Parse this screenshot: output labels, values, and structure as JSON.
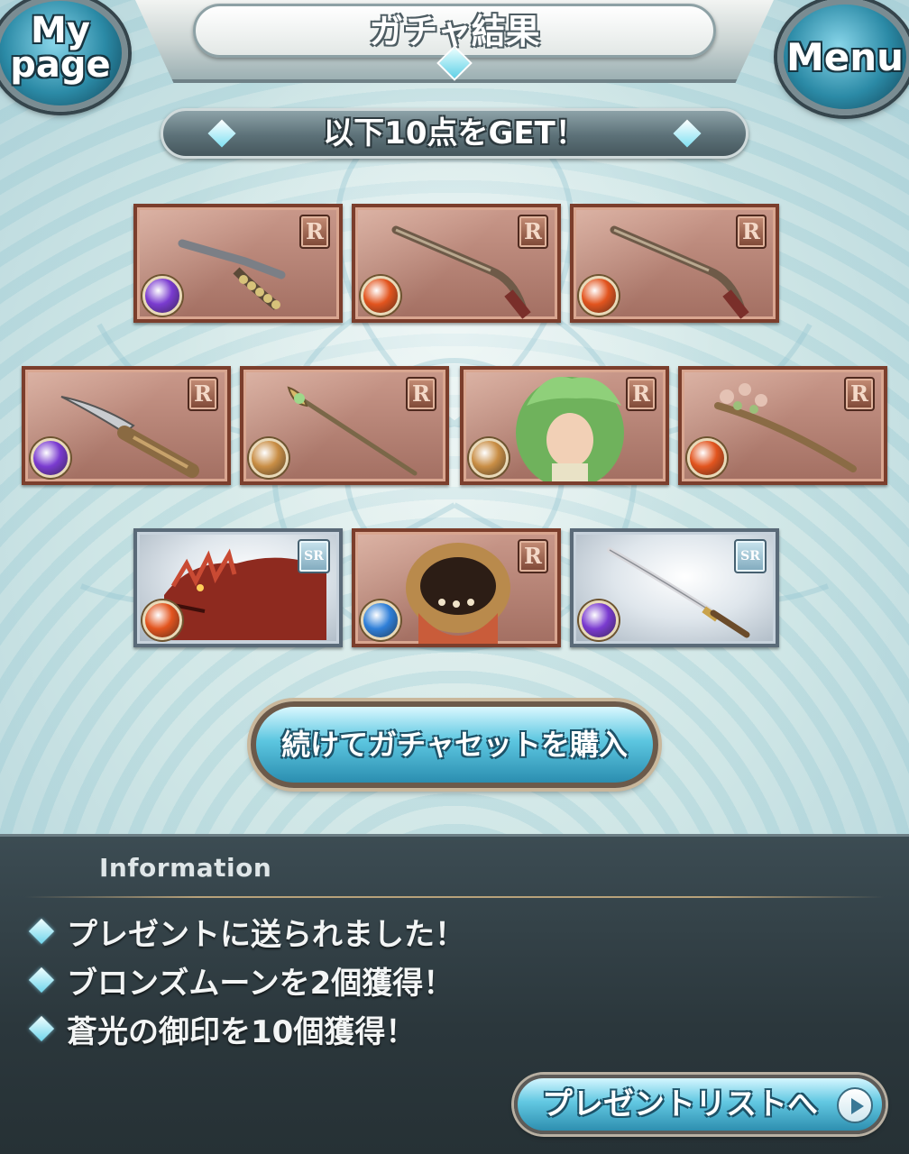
{
  "header": {
    "title": "ガチャ結果",
    "left_button": {
      "line1": "My",
      "line2": "page"
    },
    "right_button": "Menu"
  },
  "result": {
    "banner": "以下10点をGET！",
    "items": [
      {
        "kind": "weapon",
        "art": "claw",
        "rarity": "R",
        "element": "dark"
      },
      {
        "kind": "weapon",
        "art": "rifle",
        "rarity": "R",
        "element": "fire"
      },
      {
        "kind": "weapon",
        "art": "rifle",
        "rarity": "R",
        "element": "fire"
      },
      {
        "kind": "weapon",
        "art": "knife",
        "rarity": "R",
        "element": "dark"
      },
      {
        "kind": "weapon",
        "art": "staff",
        "rarity": "R",
        "element": "earth"
      },
      {
        "kind": "character",
        "art": "green-haired-girl",
        "rarity": "R",
        "element": "earth"
      },
      {
        "kind": "weapon",
        "art": "flower-staff",
        "rarity": "R",
        "element": "fire"
      },
      {
        "kind": "summon",
        "art": "red-dragon",
        "rarity": "SR",
        "element": "fire"
      },
      {
        "kind": "character",
        "art": "golden-helmet",
        "rarity": "R",
        "element": "water"
      },
      {
        "kind": "weapon",
        "art": "katana",
        "rarity": "SR",
        "element": "dark"
      }
    ],
    "continue_button": "続けてガチャセットを購入"
  },
  "info": {
    "title": "Information",
    "messages": [
      "プレゼントに送られました！",
      "ブロンズムーンを2個獲得！",
      "蒼光の御印を10個獲得！"
    ],
    "present_button": "プレゼントリストへ"
  },
  "colors": {
    "fire": "#e2541e",
    "water": "#2f7fd8",
    "earth": "#c98e45",
    "dark": "#7a3bd0",
    "card_border": "#7b3e2c",
    "accent": "#5cc6e0"
  }
}
